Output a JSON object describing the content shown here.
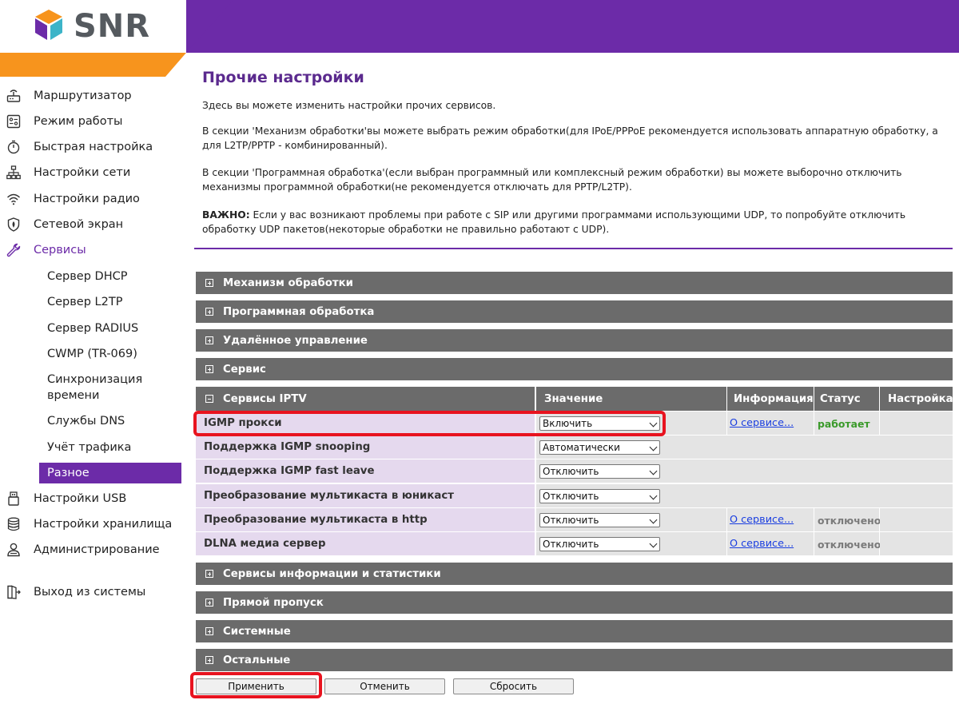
{
  "brand": {
    "name": "SNR",
    "purple": "#6c2ba8",
    "orange": "#f7941d"
  },
  "sidebar": {
    "items": [
      {
        "label": "Маршрутизатор",
        "icon": "router-icon"
      },
      {
        "label": "Режим работы",
        "icon": "mode-icon"
      },
      {
        "label": "Быстрая настройка",
        "icon": "stopwatch-icon"
      },
      {
        "label": "Настройки сети",
        "icon": "network-icon"
      },
      {
        "label": "Настройки радио",
        "icon": "wifi-icon"
      },
      {
        "label": "Сетевой экран",
        "icon": "shield-icon"
      },
      {
        "label": "Сервисы",
        "icon": "wrench-icon",
        "active": true
      },
      {
        "label": "Настройки USB",
        "icon": "usb-icon"
      },
      {
        "label": "Настройки хранилища",
        "icon": "database-icon"
      },
      {
        "label": "Администрирование",
        "icon": "admin-user-icon"
      },
      {
        "label": "Выход из системы",
        "icon": "logout-icon"
      }
    ],
    "subitems": [
      {
        "label": "Сервер DHCP"
      },
      {
        "label": "Сервер L2TP"
      },
      {
        "label": "Сервер RADIUS"
      },
      {
        "label": "CWMP (TR-069)"
      },
      {
        "label": "Синхронизация времени"
      },
      {
        "label": "Службы DNS"
      },
      {
        "label": "Учёт трафика"
      },
      {
        "label": "Разное",
        "selected": true
      }
    ]
  },
  "main": {
    "title": "Прочие настройки",
    "intro": "Здесь вы можете изменить настройки прочих сервисов.",
    "para1": "В секции 'Механизм обработки'вы можете выбрать режим обработки(для IPoE/PPPoE рекомендуется использовать аппаратную обработку, а для L2TP/PPTP - комбинированный).",
    "para2": "В секции 'Программная обработка'(если выбран программный или комплексный режим обработки) вы можете выборочно отключить механизмы программной обработки(не рекомендуется отключать для PPTP/L2TP).",
    "important_label": "ВАЖНО:",
    "important_text": " Если у вас возникают проблемы при работе с SIP или другими программами использующими UDP, то попробуйте отключить обработку UDP пакетов(некоторые обработки не правильно работают с UDP).",
    "sections_top": [
      {
        "title": "Механизм обработки"
      },
      {
        "title": "Программная обработка"
      },
      {
        "title": "Удалённое управление"
      },
      {
        "title": "Сервис"
      }
    ],
    "iptv": {
      "title": "Сервисы IPTV",
      "col_value": "Значение",
      "col_info": "Информация",
      "col_status": "Статус",
      "col_config": "Настройка",
      "rows": [
        {
          "name": "IGMP прокси",
          "value": "Включить",
          "info": "О сервисе...",
          "status": "работает",
          "status_color": "#3a9a2a"
        },
        {
          "name": "Поддержка IGMP snooping",
          "value": "Автоматически"
        },
        {
          "name": "Поддержка IGMP fast leave",
          "value": "Отключить"
        },
        {
          "name": "Преобразование мультикаста в юникаст",
          "value": "Отключить"
        },
        {
          "name": "Преобразование мультикаста в http",
          "value": "Отключить",
          "info": "О сервисе...",
          "status": "отключено",
          "status_color": "#7a7a7a"
        },
        {
          "name": "DLNA медиа сервер",
          "value": "Отключить",
          "info": "О сервисе...",
          "status": "отключено",
          "status_color": "#7a7a7a"
        }
      ]
    },
    "sections_bottom": [
      {
        "title": "Сервисы информации и статистики"
      },
      {
        "title": "Прямой пропуск"
      },
      {
        "title": "Системные"
      },
      {
        "title": "Остальные"
      }
    ],
    "buttons": {
      "apply": "Применить",
      "cancel": "Отменить",
      "reset": "Сбросить"
    }
  }
}
